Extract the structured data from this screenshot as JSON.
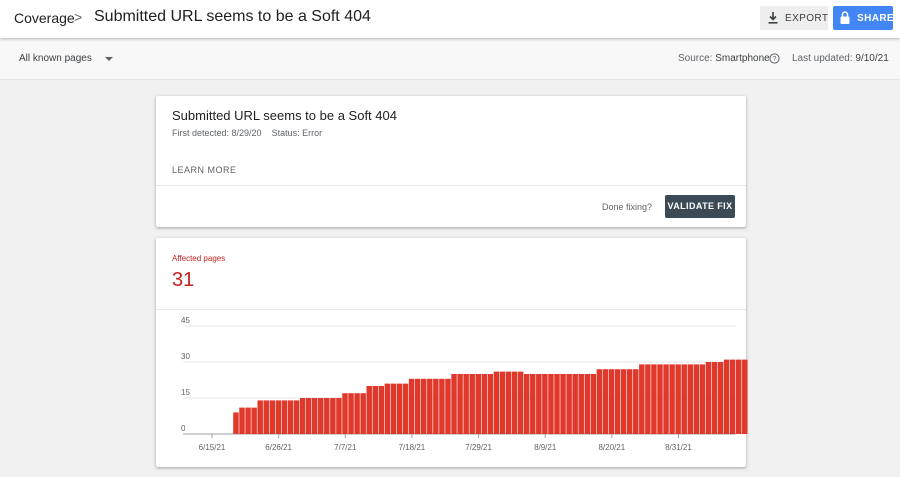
{
  "header": {
    "breadcrumb_root": "Coverage",
    "breadcrumb_sep": ">",
    "title": "Submitted URL seems to be a Soft 404",
    "export_label": "EXPORT",
    "share_label": "SHARE"
  },
  "filter": {
    "selected": "All known pages",
    "source_label": "Source:",
    "source_value": "Smartphone",
    "updated_label": "Last updated:",
    "updated_value": "9/10/21"
  },
  "issue": {
    "title": "Submitted URL seems to be a Soft 404",
    "first_detected": "First detected: 8/29/20",
    "status": "Status: Error",
    "learn_more": "LEARN MORE",
    "done_fixing": "Done fixing?",
    "validate_label": "VALIDATE FIX"
  },
  "metric": {
    "label": "Affected pages",
    "value": "31"
  },
  "colors": {
    "accent": "#4285f4",
    "error": "#c5221f",
    "bar": "#e0392b",
    "validate_bg": "#3c4a55"
  },
  "chart_data": {
    "type": "bar",
    "x": [
      "6/15/21",
      "6/16/21",
      "6/17/21",
      "6/18/21",
      "6/19/21",
      "6/20/21",
      "6/21/21",
      "6/22/21",
      "6/23/21",
      "6/24/21",
      "6/25/21",
      "6/26/21",
      "6/27/21",
      "6/28/21",
      "6/29/21",
      "6/30/21",
      "7/1/21",
      "7/2/21",
      "7/3/21",
      "7/4/21",
      "7/5/21",
      "7/6/21",
      "7/7/21",
      "7/8/21",
      "7/9/21",
      "7/10/21",
      "7/11/21",
      "7/12/21",
      "7/13/21",
      "7/14/21",
      "7/15/21",
      "7/16/21",
      "7/17/21",
      "7/18/21",
      "7/19/21",
      "7/20/21",
      "7/21/21",
      "7/22/21",
      "7/23/21",
      "7/24/21",
      "7/25/21",
      "7/26/21",
      "7/27/21",
      "7/28/21",
      "7/29/21",
      "7/30/21",
      "7/31/21",
      "8/1/21",
      "8/2/21",
      "8/3/21",
      "8/4/21",
      "8/5/21",
      "8/6/21",
      "8/7/21",
      "8/8/21",
      "8/9/21",
      "8/10/21",
      "8/11/21",
      "8/12/21",
      "8/13/21",
      "8/14/21",
      "8/15/21",
      "8/16/21",
      "8/17/21",
      "8/18/21",
      "8/19/21",
      "8/20/21",
      "8/21/21",
      "8/22/21",
      "8/23/21",
      "8/24/21",
      "8/25/21",
      "8/26/21",
      "8/27/21",
      "8/28/21",
      "8/29/21",
      "8/30/21",
      "8/31/21",
      "9/1/21",
      "9/2/21",
      "9/3/21",
      "9/4/21",
      "9/5/21",
      "9/6/21",
      "9/7/21",
      "9/8/21",
      "9/9/21"
    ],
    "values": [
      0,
      0,
      0,
      0,
      9,
      11,
      11,
      11,
      14,
      14,
      14,
      14,
      14,
      14,
      14,
      15,
      15,
      15,
      15,
      15,
      15,
      15,
      17,
      17,
      17,
      17,
      20,
      20,
      20,
      21,
      21,
      21,
      21,
      23,
      23,
      23,
      23,
      23,
      23,
      23,
      25,
      25,
      25,
      25,
      25,
      25,
      25,
      26,
      26,
      26,
      26,
      26,
      25,
      25,
      25,
      25,
      25,
      25,
      25,
      25,
      25,
      25,
      25,
      25,
      27,
      27,
      27,
      27,
      27,
      27,
      27,
      29,
      29,
      29,
      29,
      29,
      29,
      29,
      29,
      29,
      29,
      29,
      30,
      30,
      30,
      31,
      31,
      31,
      31
    ],
    "xticks": [
      "6/15/21",
      "6/26/21",
      "7/7/21",
      "7/18/21",
      "7/29/21",
      "8/9/21",
      "8/20/21",
      "8/31/21"
    ],
    "yticks": [
      "0",
      "15",
      "30",
      "45"
    ],
    "ylim": [
      0,
      45
    ],
    "grid": true
  }
}
